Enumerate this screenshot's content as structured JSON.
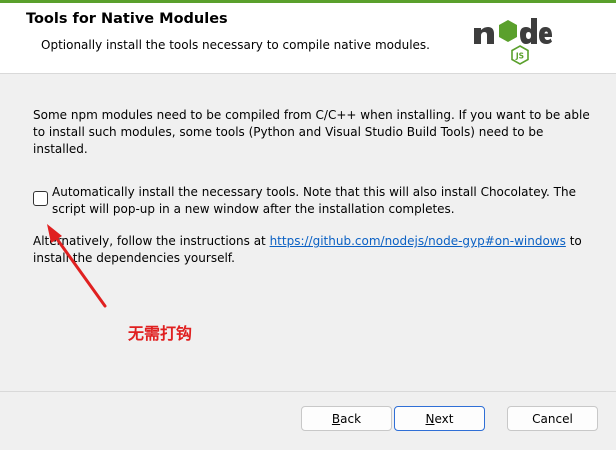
{
  "header": {
    "title": "Tools for Native Modules",
    "subtitle": "Optionally install the tools necessary to compile native modules.",
    "logo_text": "node",
    "logo_badge": "JS"
  },
  "content": {
    "paragraph1": "Some npm modules need to be compiled from C/C++ when installing. If you want to be able to install such modules, some tools (Python and Visual Studio Build Tools) need to be installed.",
    "checkbox": {
      "checked": false,
      "label": "Automatically install the necessary tools. Note that this will also install Chocolatey. The script will pop-up in a new window after the installation completes."
    },
    "paragraph2_prefix": "Alternatively, follow the instructions at ",
    "link_text": "https://github.com/nodejs/node-gyp#on-windows",
    "paragraph2_suffix": " to install the dependencies yourself."
  },
  "annotation": {
    "text": "无需打钩",
    "color": "#e02020"
  },
  "buttons": {
    "back": {
      "mnemonic": "B",
      "rest": "ack"
    },
    "next": {
      "mnemonic": "N",
      "rest": "ext"
    },
    "cancel": "Cancel"
  },
  "colors": {
    "accent": "#5aa02c",
    "link": "#0b61c4"
  }
}
